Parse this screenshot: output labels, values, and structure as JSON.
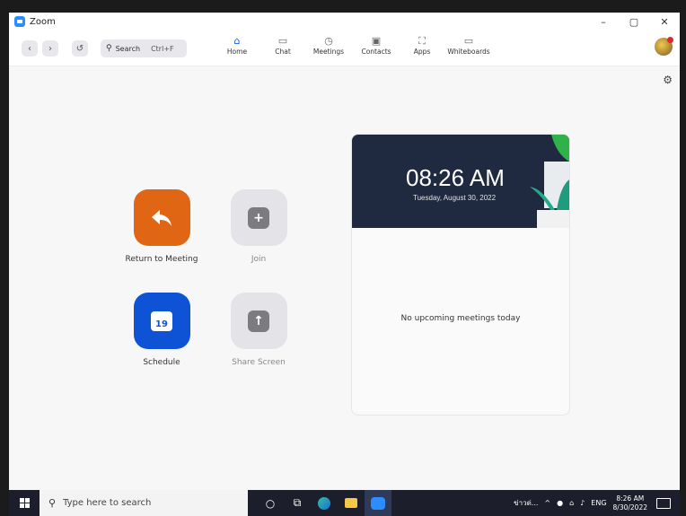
{
  "window": {
    "title": "Zoom",
    "controls": [
      "–",
      "▢",
      "✕"
    ]
  },
  "toolbar": {
    "search_label": "Search",
    "search_shortcut": "Ctrl+F",
    "tabs": [
      {
        "label": "Home",
        "icon": "⌂"
      },
      {
        "label": "Chat",
        "icon": "▭"
      },
      {
        "label": "Meetings",
        "icon": "◷"
      },
      {
        "label": "Contacts",
        "icon": "▣"
      },
      {
        "label": "Apps",
        "icon": "⛶"
      },
      {
        "label": "Whiteboards",
        "icon": "▭"
      }
    ]
  },
  "actions": {
    "return": "Return to Meeting",
    "join": "Join",
    "schedule": "Schedule",
    "schedule_day": "19",
    "share": "Share Screen"
  },
  "clock": {
    "time": "08:26 AM",
    "date": "Tuesday, August 30, 2022"
  },
  "meetings": {
    "empty": "No upcoming meetings today"
  },
  "taskbar": {
    "search_placeholder": "Type here to search",
    "news": "ข่าวด่...",
    "language": "ENG",
    "time": "8:26 AM",
    "date": "8/30/2022"
  },
  "colors": {
    "accent": "#0b5cff",
    "return_tile": "#e06614",
    "schedule_tile": "#0e52d6",
    "header": "#1f2a40"
  }
}
